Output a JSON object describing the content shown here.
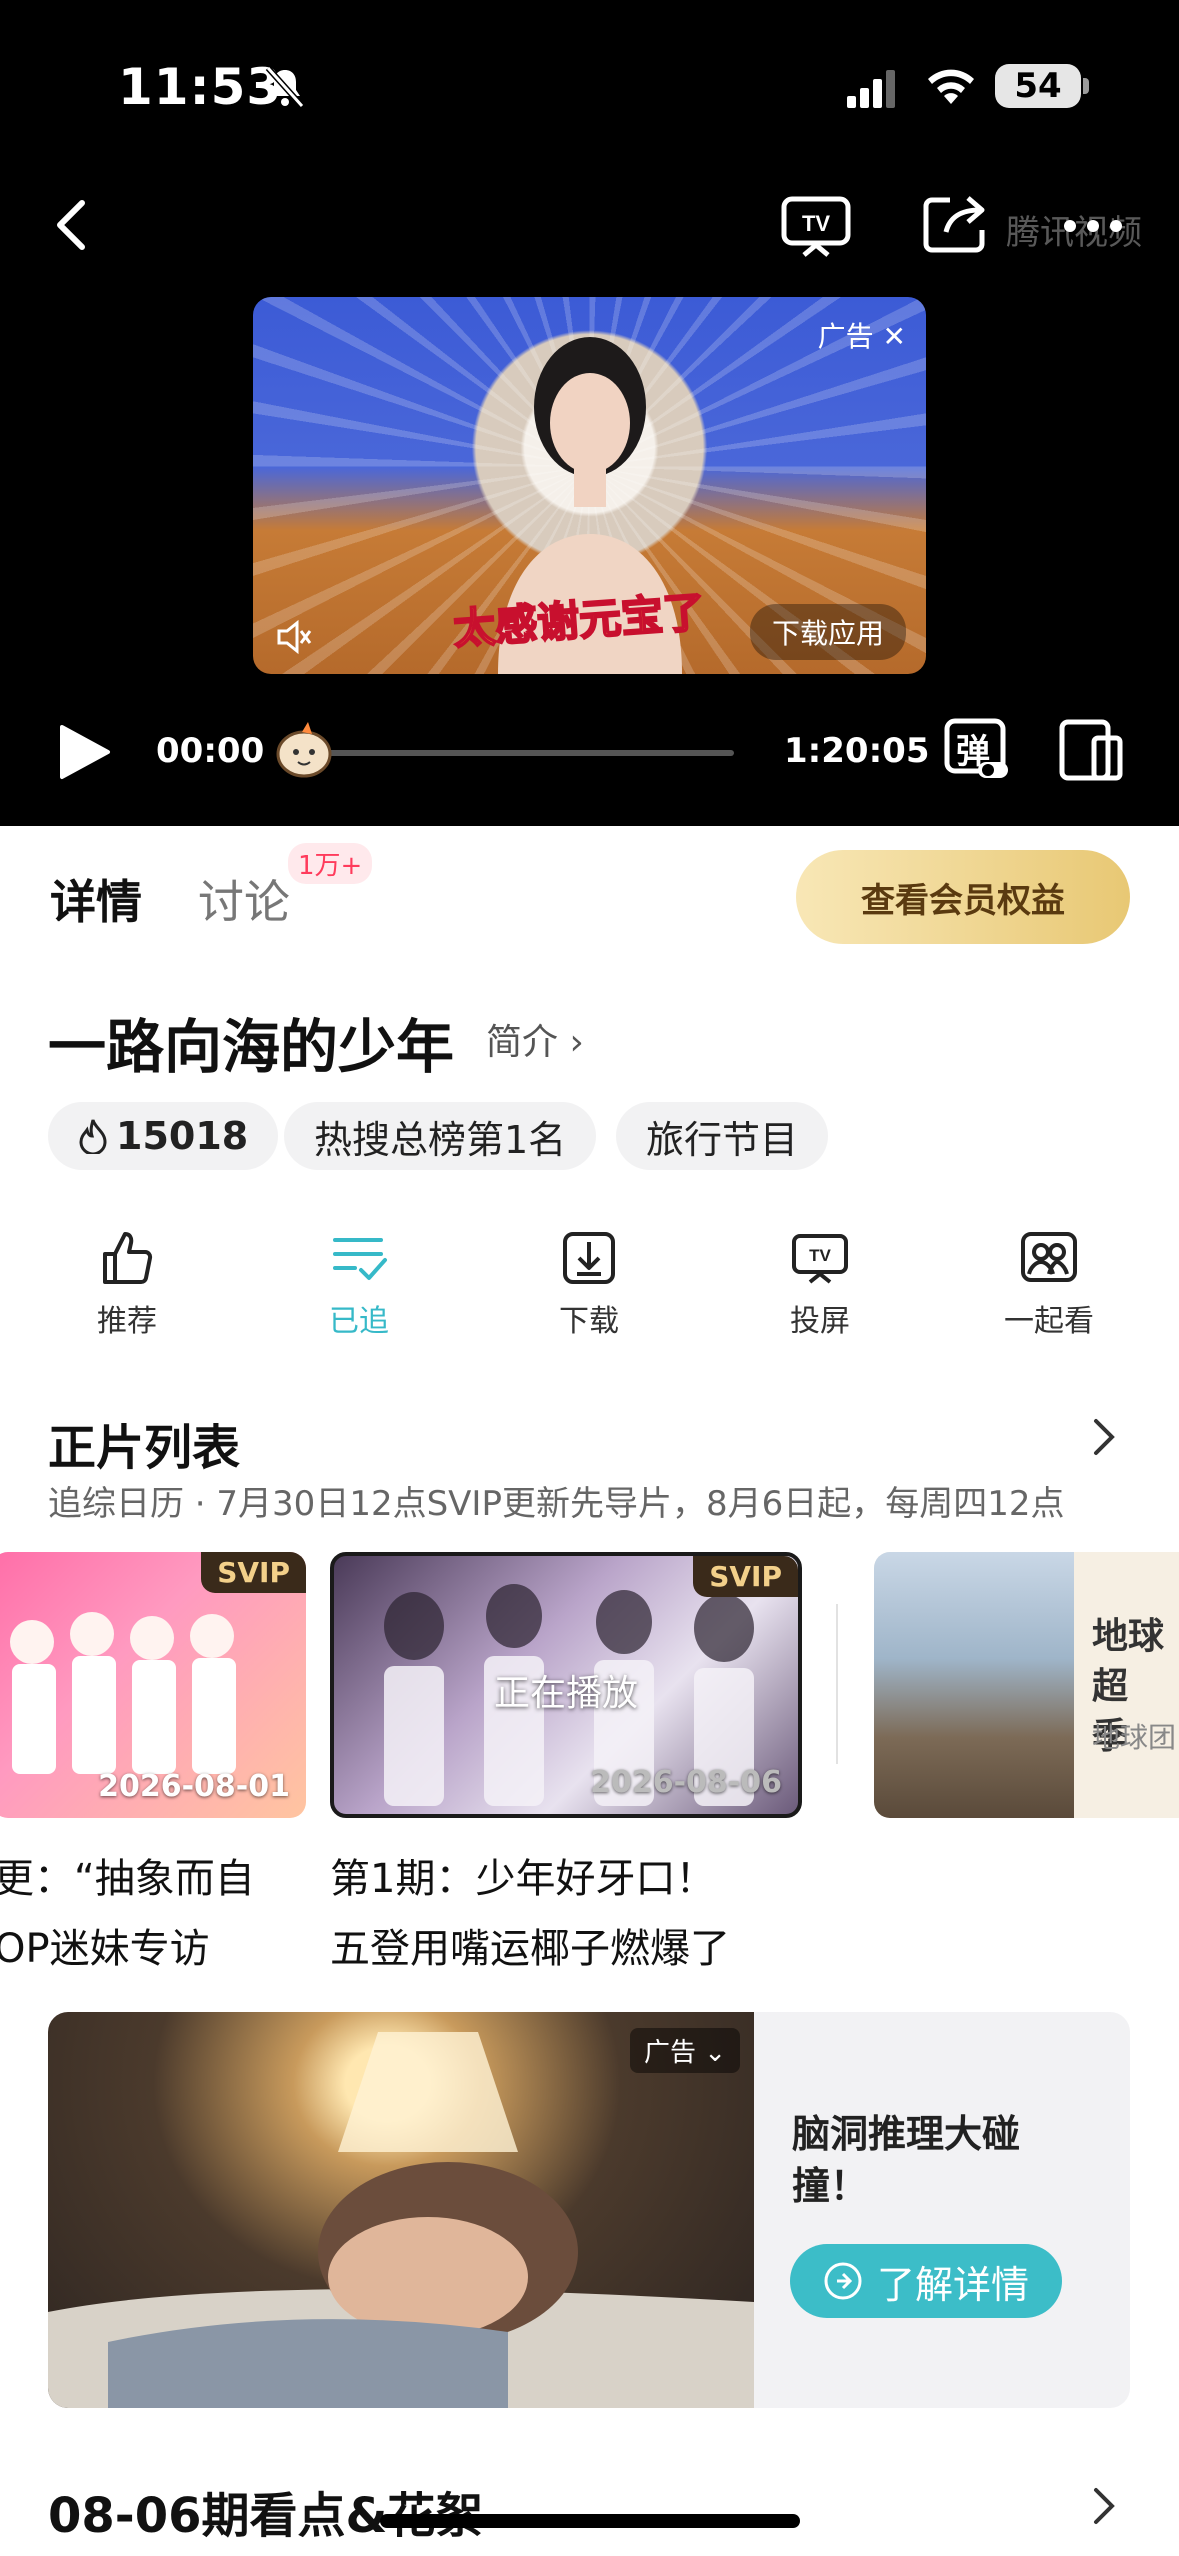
{
  "status_bar": {
    "time": "11:53",
    "battery": "54"
  },
  "player": {
    "watermark": "腾讯视频",
    "current_time": "00:00",
    "duration": "1:20:05",
    "danmu_label": "弹",
    "ad": {
      "tag": "广告 ✕",
      "caption": "太感谢元宝了",
      "download_label": "下载应用"
    }
  },
  "tabs": {
    "detail": "详情",
    "discuss": "讨论",
    "discuss_badge": "1万+"
  },
  "vip_button": "查看会员权益",
  "show": {
    "title": "一路向海的少年",
    "intro_link": "简介 ›"
  },
  "chips": {
    "heat": "15018",
    "rank": "热搜总榜第1名",
    "genre": "旅行节目"
  },
  "actions": [
    {
      "label": "推荐"
    },
    {
      "label": "已追"
    },
    {
      "label": "下载"
    },
    {
      "label": "投屏"
    },
    {
      "label": "一起看"
    }
  ],
  "episode_list": {
    "title": "正片列表",
    "subtitle": "追综日历 · 7月30日12点SVIP更新先导片，8月6日起，每周四12点",
    "episodes": [
      {
        "badge": "SVIP",
        "date": "2026-08-01",
        "line1": "更：“抽象而自",
        "line2": "OP迷妹专访"
      },
      {
        "badge": "SVIP",
        "date": "2026-08-06",
        "status": "正在播放",
        "line1": "第1期：少年好牙口！",
        "line2": "五登用嘴运椰子燃爆了"
      }
    ],
    "related": {
      "title_line1": "地球超",
      "title_line2": "季",
      "subtitle": "地球团"
    }
  },
  "ad_banner": {
    "tag": "广告 ⌄",
    "title": "脑洞推理大碰撞！",
    "button": "了解详情"
  },
  "bottom_section": {
    "title": "08-06期看点&花絮"
  }
}
